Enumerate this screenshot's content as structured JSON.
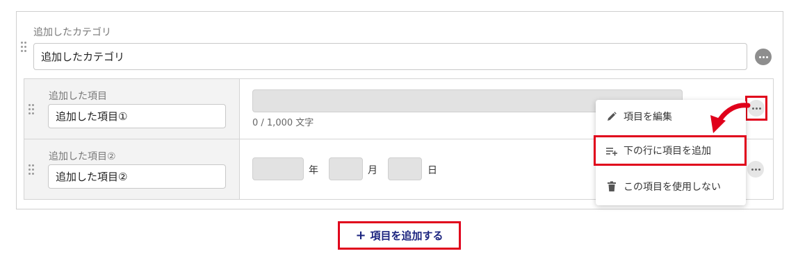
{
  "category": {
    "label": "追加したカテゴリ",
    "value": "追加したカテゴリ"
  },
  "rows": [
    {
      "label": "追加した項目",
      "value": "追加した項目①",
      "char_count": "0 / 1,000 文字"
    },
    {
      "label": "追加した項目②",
      "value": "追加した項目②",
      "date_units": [
        "年",
        "月",
        "日"
      ]
    }
  ],
  "context_menu": {
    "items": [
      {
        "label": "項目を編集",
        "icon": "pencil-icon"
      },
      {
        "label": "下の行に項目を追加",
        "icon": "add-row-icon"
      },
      {
        "label": "この項目を使用しない",
        "icon": "trash-icon"
      }
    ]
  },
  "add_item_button": {
    "label": "項目を追加する"
  },
  "colors": {
    "highlight": "#e0001b",
    "button_text": "#1a237e",
    "arrow": "#e0001b"
  }
}
